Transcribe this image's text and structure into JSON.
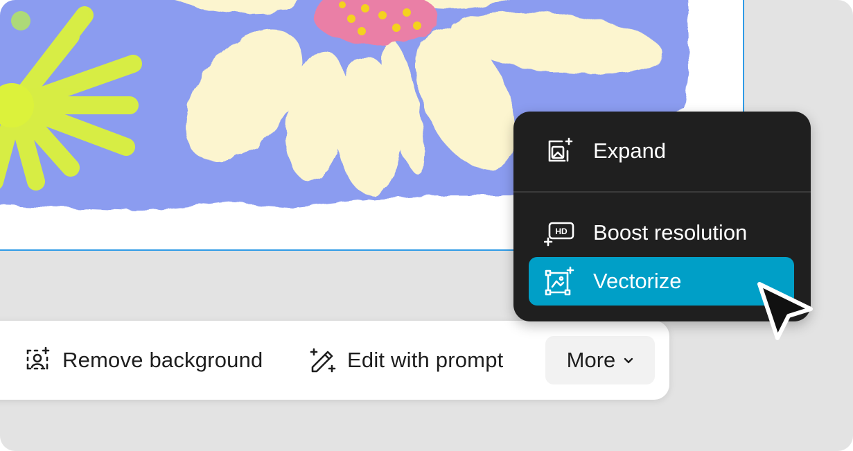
{
  "toolbar": {
    "remove_background": {
      "label": "Remove background",
      "icon": "remove-background-icon"
    },
    "edit_with_prompt": {
      "label": "Edit with prompt",
      "icon": "magic-wand-icon"
    },
    "more": {
      "label": "More",
      "icon": "chevron-down-icon"
    }
  },
  "menu": {
    "items": [
      {
        "label": "Expand",
        "icon": "expand-image-icon"
      },
      {
        "label": "Boost resolution",
        "icon": "hd-icon"
      },
      {
        "label": "Vectorize",
        "icon": "vectorize-icon",
        "active": true
      }
    ]
  },
  "colors": {
    "background": "#e3e3e3",
    "selection_border": "#2f9be6",
    "menu_background": "#1f1f1f",
    "active_item": "#009fc7",
    "artwork_blue": "#8b9cf0",
    "petal_cream": "#fcf5cf",
    "center_pink": "#ea7fa6",
    "flower_yellow": "#dcf23b"
  }
}
